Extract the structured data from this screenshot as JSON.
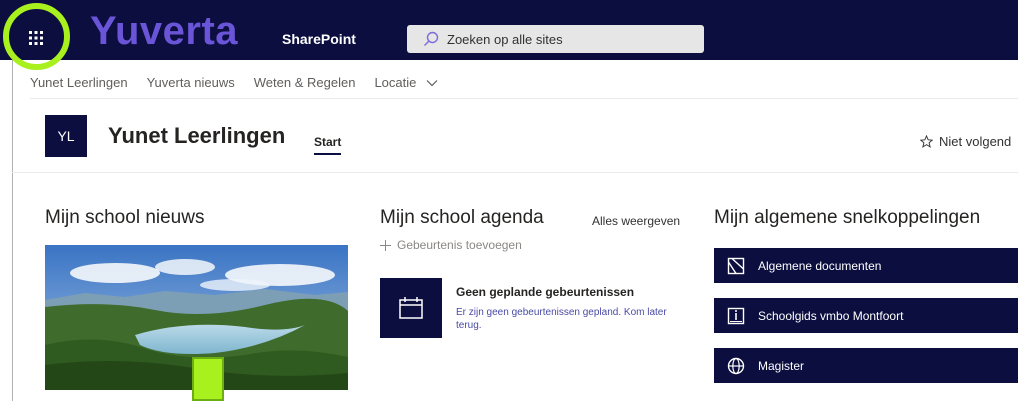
{
  "suitebar": {
    "brand": "Yuverta",
    "app_name": "SharePoint",
    "search_placeholder": "Zoeken op alle sites",
    "colors": {
      "bar": "#0b0e3f",
      "brand": "#6a55d8",
      "highlight": "#a8f01e"
    }
  },
  "hubnav": {
    "items": [
      {
        "label": "Yunet Leerlingen"
      },
      {
        "label": "Yuverta nieuws"
      },
      {
        "label": "Weten & Regelen"
      },
      {
        "label": "Locatie"
      }
    ]
  },
  "site": {
    "logo_initials": "YL",
    "title": "Yunet Leerlingen",
    "tab": "Start",
    "follow_label": "Niet volgend"
  },
  "news": {
    "title": "Mijn school nieuws"
  },
  "agenda": {
    "title": "Mijn school agenda",
    "see_all": "Alles weergeven",
    "add_event": "Gebeurtenis toevoegen",
    "empty_title": "Geen geplande gebeurtenissen",
    "empty_body": "Er zijn geen gebeurtenissen gepland. Kom later terug."
  },
  "quicklinks": {
    "title": "Mijn algemene snelkoppelingen",
    "items": [
      {
        "label": "Algemene documenten",
        "icon": "document-icon"
      },
      {
        "label": "Schoolgids vmbo Montfoort",
        "icon": "info-book-icon"
      },
      {
        "label": "Magister",
        "icon": "globe-icon"
      }
    ]
  }
}
